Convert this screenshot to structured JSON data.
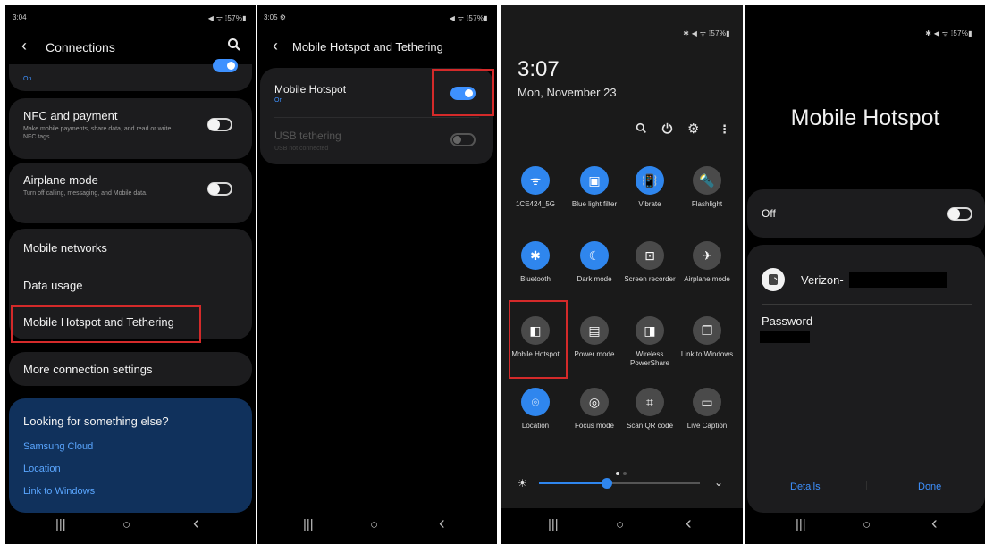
{
  "panel1": {
    "status": {
      "time": "3:04",
      "right": "◀ ᯤ ⁞57%▮"
    },
    "header": {
      "title": "Connections"
    },
    "partial_on": "On",
    "nfc": {
      "title": "NFC and payment",
      "sub": "Make mobile payments, share data, and read or write NFC tags."
    },
    "airplane": {
      "title": "Airplane mode",
      "sub": "Turn off calling, messaging, and Mobile data."
    },
    "items": [
      "Mobile networks",
      "Data usage",
      "Mobile Hotspot and Tethering"
    ],
    "more": "More connection settings",
    "looking": {
      "title": "Looking for something else?",
      "links": [
        "Samsung Cloud",
        "Location",
        "Link to Windows"
      ]
    }
  },
  "panel2": {
    "status": {
      "time": "3:05 ⚙",
      "right": "◀ ᯤ ⁞57%▮"
    },
    "header": {
      "title": "Mobile Hotspot and Tethering"
    },
    "hotspot": {
      "title": "Mobile Hotspot",
      "state": "On",
      "enabled": true
    },
    "usb": {
      "title": "USB tethering",
      "sub": "USB not connected",
      "enabled": false
    }
  },
  "panel3": {
    "status": {
      "right": "✱ ◀ ᯤ ⁞57%▮"
    },
    "time": "3:07",
    "date": "Mon, November 23",
    "tiles": [
      {
        "label": "1CE424_5G",
        "icon": "wifi-icon",
        "active": true
      },
      {
        "label": "Blue light filter",
        "icon": "blue-light-icon",
        "active": true
      },
      {
        "label": "Vibrate",
        "icon": "vibrate-icon",
        "active": true
      },
      {
        "label": "Flashlight",
        "icon": "flashlight-icon",
        "active": false
      },
      {
        "label": "Bluetooth",
        "icon": "bluetooth-icon",
        "active": true
      },
      {
        "label": "Dark mode",
        "icon": "dark-mode-icon",
        "active": true
      },
      {
        "label": "Screen recorder",
        "icon": "screen-recorder-icon",
        "active": false
      },
      {
        "label": "Airplane mode",
        "icon": "airplane-icon",
        "active": false
      },
      {
        "label": "Mobile Hotspot",
        "icon": "hotspot-icon",
        "active": false
      },
      {
        "label": "Power mode",
        "icon": "power-mode-icon",
        "active": false
      },
      {
        "label": "Wireless PowerShare",
        "icon": "powershare-icon",
        "active": false
      },
      {
        "label": "Link to Windows",
        "icon": "link-windows-icon",
        "active": false
      },
      {
        "label": "Location",
        "icon": "location-icon",
        "active": true
      },
      {
        "label": "Focus mode",
        "icon": "focus-icon",
        "active": false
      },
      {
        "label": "Scan QR code",
        "icon": "qr-icon",
        "active": false
      },
      {
        "label": "Live Caption",
        "icon": "caption-icon",
        "active": false
      }
    ],
    "brightness_level": 0.42
  },
  "panel4": {
    "status": {
      "right": "✱ ◀ ᯤ ⁞57%▮"
    },
    "title": "Mobile Hotspot",
    "switch_label": "Off",
    "network": "Verizon-",
    "password_label": "Password",
    "details": "Details",
    "done": "Done"
  },
  "nav": {
    "recents": "|||",
    "home": "○",
    "back": "‹"
  },
  "colors": {
    "accent": "#3e91ff",
    "highlight": "#d42a2a",
    "tile_active": "#2f86ee"
  }
}
